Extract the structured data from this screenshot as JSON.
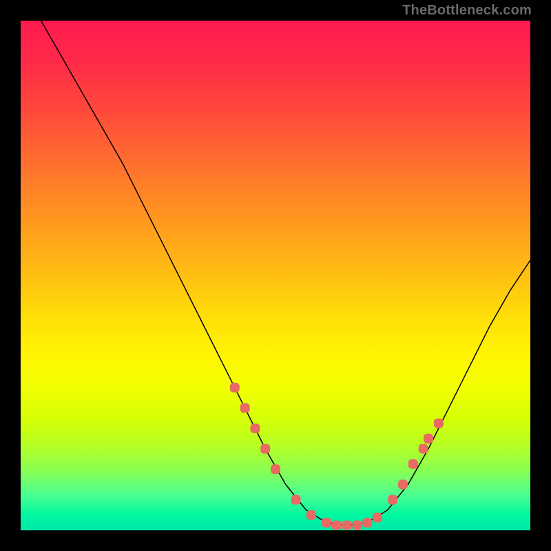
{
  "watermark": "TheBottleneck.com",
  "colors": {
    "background": "#000000",
    "curve": "#000000",
    "marker": "#e86a63"
  },
  "chart_data": {
    "type": "line",
    "title": "",
    "xlabel": "",
    "ylabel": "",
    "xlim": [
      0,
      100
    ],
    "ylim": [
      0,
      100
    ],
    "grid": false,
    "legend": false,
    "series": [
      {
        "name": "bottleneck-curve",
        "x": [
          4,
          8,
          12,
          16,
          20,
          24,
          28,
          32,
          36,
          40,
          44,
          48,
          52,
          56,
          60,
          64,
          68,
          72,
          76,
          80,
          84,
          88,
          92,
          96,
          100
        ],
        "y": [
          100,
          93,
          86,
          79,
          72,
          64,
          56,
          48,
          40,
          32,
          24,
          16,
          9,
          4,
          1.5,
          1,
          1.5,
          4,
          9,
          16,
          24,
          32,
          40,
          47,
          53
        ]
      }
    ],
    "markers": {
      "name": "highlighted-points",
      "shape": "rounded-square",
      "color": "#e86a63",
      "x": [
        42,
        44,
        46,
        48,
        50,
        54,
        57,
        60,
        62,
        64,
        66,
        68,
        70,
        73,
        75,
        77,
        79,
        80,
        82
      ],
      "y": [
        28,
        24,
        20,
        16,
        12,
        6,
        3,
        1.5,
        1,
        1,
        1,
        1.5,
        2.5,
        6,
        9,
        13,
        16,
        18,
        21
      ]
    }
  }
}
